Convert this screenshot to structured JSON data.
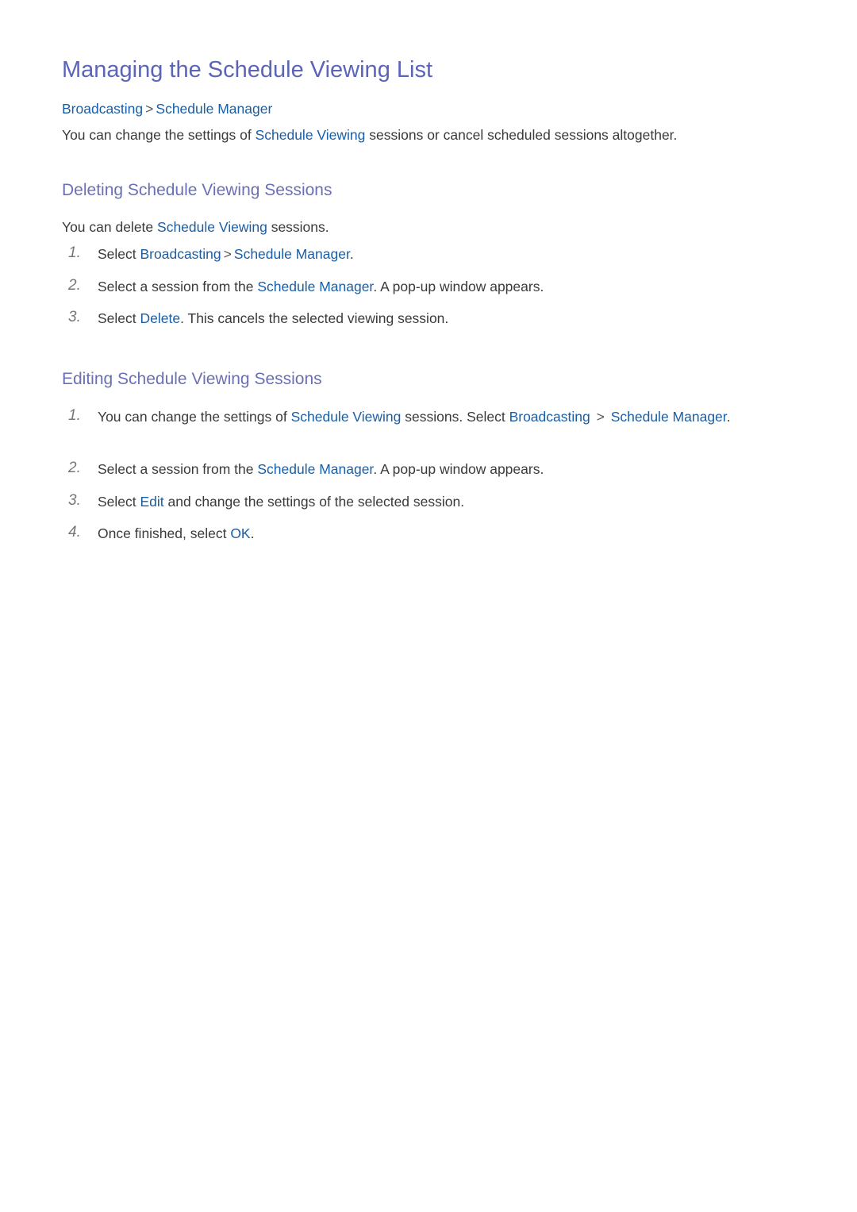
{
  "page": {
    "title": "Managing the Schedule Viewing List",
    "breadcrumb": {
      "items": [
        "Broadcasting",
        "Schedule Manager"
      ],
      "separator": ">"
    },
    "intro": {
      "pre": "You can change the settings of ",
      "link": "Schedule Viewing",
      "post": " sessions or cancel scheduled sessions altogether."
    }
  },
  "deleting": {
    "heading": "Deleting Schedule Viewing Sessions",
    "intro": {
      "pre": "You can delete ",
      "link": "Schedule Viewing",
      "post": " sessions."
    },
    "steps": [
      {
        "num": "1.",
        "pre": "Select ",
        "link1": "Broadcasting",
        "sep": ">",
        "link2": "Schedule Manager",
        "post": "."
      },
      {
        "num": "2.",
        "pre": "Select a session from the ",
        "link": "Schedule Manager",
        "post": ". A pop-up window appears."
      },
      {
        "num": "3.",
        "pre": "Select ",
        "link": "Delete",
        "post": ". This cancels the selected viewing session."
      }
    ]
  },
  "editing": {
    "heading": "Editing Schedule Viewing Sessions",
    "steps": [
      {
        "num": "1.",
        "pre": "You can change the settings of ",
        "link1": "Schedule Viewing",
        "mid": " sessions. Select ",
        "link2": "Broadcasting",
        "sep": ">",
        "link3": "Schedule Manager",
        "post": "."
      },
      {
        "num": "2.",
        "pre": "Select a session from the ",
        "link": "Schedule Manager",
        "post": ". A pop-up window appears."
      },
      {
        "num": "3.",
        "pre": "Select ",
        "link": "Edit",
        "post": " and change the settings of the selected session."
      },
      {
        "num": "4.",
        "pre": "Once finished, select ",
        "link": "OK",
        "post": "."
      }
    ]
  },
  "colors": {
    "title": "#5b64b8",
    "heading": "#6a70b5",
    "link": "#1a5ea6",
    "body": "#3a3a3a"
  }
}
